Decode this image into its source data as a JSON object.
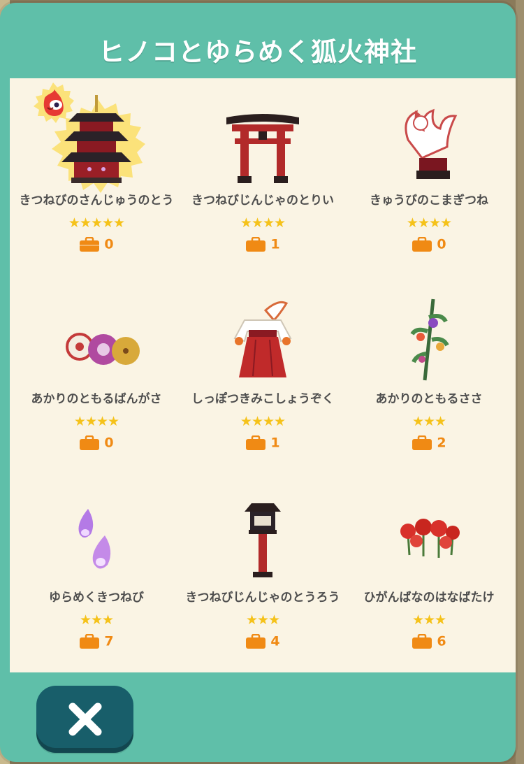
{
  "title": "ヒノコとゆらめく狐火神社",
  "close_button": {
    "icon": "close-x-icon"
  },
  "items": [
    {
      "name": "きつねびのさんじゅうのとう",
      "stars": "★★★★★",
      "count": "0",
      "icon": "three-story-pagoda-icon",
      "highlighted": true,
      "badge_icon": "hinoko-mascot-icon"
    },
    {
      "name": "きつねびじんじゃのとりい",
      "stars": "★★★★",
      "count": "1",
      "icon": "torii-gate-icon"
    },
    {
      "name": "きゅうびのこまぎつね",
      "stars": "★★★★",
      "count": "0",
      "icon": "nine-tailed-fox-statue-icon"
    },
    {
      "name": "あかりのともるばんがさ",
      "stars": "★★★★",
      "count": "0",
      "icon": "paper-umbrellas-icon"
    },
    {
      "name": "しっぽつきみこしょうぞく",
      "stars": "★★★★",
      "count": "1",
      "icon": "shrine-maiden-outfit-icon"
    },
    {
      "name": "あかりのともるささ",
      "stars": "★★★",
      "count": "2",
      "icon": "bamboo-with-lanterns-icon"
    },
    {
      "name": "ゆらめくきつねび",
      "stars": "★★★",
      "count": "7",
      "icon": "fox-fire-wisps-icon"
    },
    {
      "name": "きつねびじんじゃのとうろう",
      "stars": "★★★",
      "count": "4",
      "icon": "shrine-lantern-icon"
    },
    {
      "name": "ひがんばなのはなばたけ",
      "stars": "★★★",
      "count": "6",
      "icon": "red-spider-lily-field-icon"
    }
  ],
  "colors": {
    "header": "#5fbfa9",
    "content_bg": "#faf4e4",
    "star": "#f5c21a",
    "count": "#f08a14",
    "name": "#4e4e4e",
    "close_button": "#185e6a"
  }
}
